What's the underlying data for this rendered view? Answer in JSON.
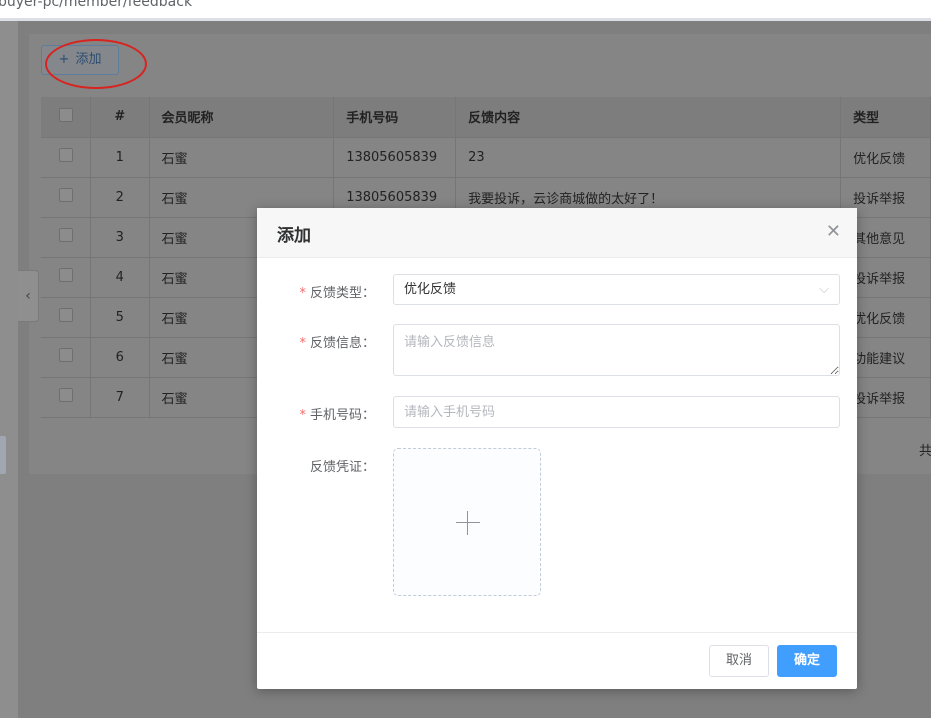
{
  "browser": {
    "url": "buyer-pc/member/feedback"
  },
  "toolbar": {
    "add_label": "添加"
  },
  "table": {
    "headers": {
      "index": "#",
      "nickname": "会员昵称",
      "phone": "手机号码",
      "content": "反馈内容",
      "type": "类型"
    },
    "rows": [
      {
        "index": "1",
        "nickname": "石蜜",
        "phone": "13805605839",
        "content": "23",
        "type": "优化反馈"
      },
      {
        "index": "2",
        "nickname": "石蜜",
        "phone": "13805605839",
        "content": "我要投诉，云诊商城做的太好了！",
        "type": "投诉举报"
      },
      {
        "index": "3",
        "nickname": "石蜜",
        "phone": "",
        "content": "",
        "type": "其他意见"
      },
      {
        "index": "4",
        "nickname": "石蜜",
        "phone": "",
        "content": "",
        "type": "投诉举报"
      },
      {
        "index": "5",
        "nickname": "石蜜",
        "phone": "",
        "content": "",
        "type": "优化反馈"
      },
      {
        "index": "6",
        "nickname": "石蜜",
        "phone": "",
        "content": "",
        "type": "功能建议"
      },
      {
        "index": "7",
        "nickname": "石蜜",
        "phone": "",
        "content": "",
        "type": "投诉举报"
      }
    ],
    "total_prefix": "共"
  },
  "dialog": {
    "title": "添加",
    "close_icon": "close-icon",
    "fields": {
      "type": {
        "label": "反馈类型：",
        "value": "优化反馈",
        "required": true
      },
      "info": {
        "label": "反馈信息：",
        "placeholder": "请输入反馈信息",
        "required": true
      },
      "phone": {
        "label": "手机号码：",
        "placeholder": "请输入手机号码",
        "required": true
      },
      "evidence": {
        "label": "反馈凭证：",
        "required": false
      }
    },
    "cancel_label": "取消",
    "ok_label": "确定"
  },
  "colors": {
    "primary": "#409eff",
    "required": "#f56c6c",
    "annotation": "#d8231e"
  }
}
